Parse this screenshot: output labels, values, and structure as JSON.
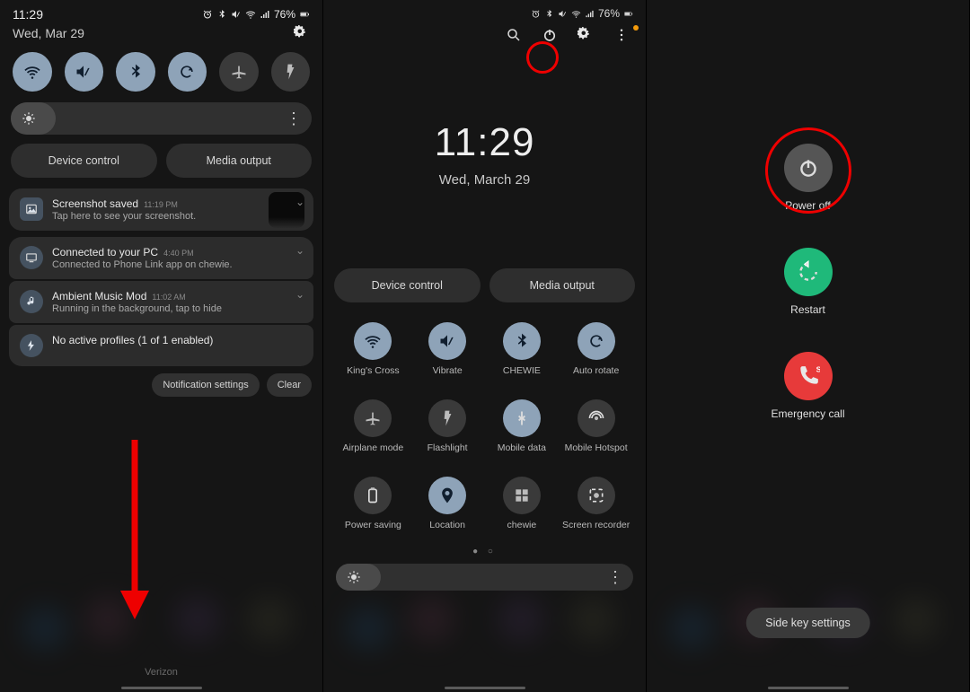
{
  "status": {
    "time": "11:29",
    "battery": "76%",
    "icons": [
      "alarm-icon",
      "bluetooth-icon",
      "mute-icon",
      "wifi-icon",
      "signal-icon",
      "battery-icon"
    ]
  },
  "p1": {
    "date": "Wed, Mar 29",
    "device_control": "Device control",
    "media_output": "Media output",
    "notifications": [
      {
        "title": "Screenshot saved",
        "time": "11:19 PM",
        "desc": "Tap here to see your screenshot.",
        "icon": "image",
        "thumb": true
      },
      {
        "title": "Connected to your PC",
        "time": "4:40 PM",
        "desc": "Connected to Phone Link app on chewie.",
        "icon": "pc"
      },
      {
        "title": "Ambient Music Mod",
        "time": "11:02 AM",
        "desc": "Running in the background, tap to hide",
        "icon": "note"
      },
      {
        "title": "No active profiles (1 of 1 enabled)",
        "time": "",
        "desc": "",
        "icon": "bolt"
      }
    ],
    "chip_notif_settings": "Notification settings",
    "chip_clear": "Clear",
    "carrier": "Verizon",
    "qtoggles": [
      "wifi",
      "mute",
      "bluetooth",
      "rotate",
      "airplane",
      "flashlight"
    ]
  },
  "p2": {
    "clock": "11:29",
    "date": "Wed, March 29",
    "device_control": "Device control",
    "media_output": "Media output",
    "grid": [
      {
        "label": "King's Cross",
        "icon": "wifi",
        "active": true
      },
      {
        "label": "Vibrate",
        "icon": "mute",
        "active": true
      },
      {
        "label": "CHEWIE",
        "icon": "bluetooth",
        "active": true
      },
      {
        "label": "Auto rotate",
        "icon": "rotate",
        "active": true
      },
      {
        "label": "Airplane mode",
        "icon": "airplane",
        "active": false
      },
      {
        "label": "Flashlight",
        "icon": "flashlight",
        "active": false
      },
      {
        "label": "Mobile data",
        "icon": "data",
        "active": true
      },
      {
        "label": "Mobile Hotspot",
        "icon": "hotspot",
        "active": false
      },
      {
        "label": "Power saving",
        "icon": "battery",
        "active": false
      },
      {
        "label": "Location",
        "icon": "location",
        "active": true
      },
      {
        "label": "chewie",
        "icon": "windows",
        "active": false
      },
      {
        "label": "Screen recorder",
        "icon": "recorder",
        "active": false
      }
    ]
  },
  "p3": {
    "power_off": "Power off",
    "restart": "Restart",
    "emergency": "Emergency call",
    "sidekey": "Side key settings"
  }
}
